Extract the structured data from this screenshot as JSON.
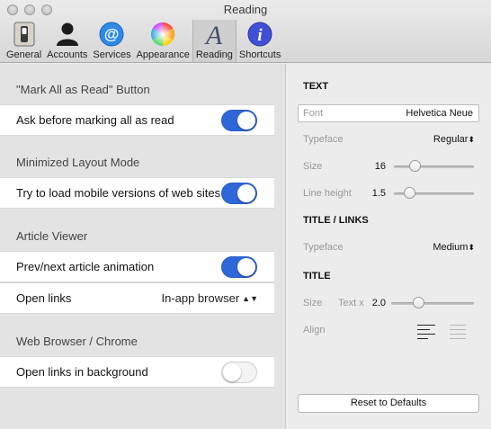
{
  "window": {
    "title": "Reading"
  },
  "toolbar": {
    "items": [
      {
        "label": "General",
        "icon": "switch-icon"
      },
      {
        "label": "Accounts",
        "icon": "person-icon"
      },
      {
        "label": "Services",
        "icon": "at-sign-icon"
      },
      {
        "label": "Appearance",
        "icon": "color-wheel-icon"
      },
      {
        "label": "Reading",
        "icon": "typeface-a-icon"
      },
      {
        "label": "Shortcuts",
        "icon": "info-icon"
      }
    ],
    "active": "Reading"
  },
  "left": {
    "sections": [
      {
        "header": "\"Mark All as Read\" Button"
      },
      {
        "header": "Minimized Layout Mode"
      },
      {
        "header": "Article Viewer"
      },
      {
        "header": "Web Browser / Chrome"
      }
    ],
    "rows": {
      "ask_before": {
        "label": "Ask before marking all as read",
        "on": true
      },
      "mobile_versions": {
        "label": "Try to load mobile versions of web sites",
        "on": true
      },
      "prev_next": {
        "label": "Prev/next article animation",
        "on": true
      },
      "open_links": {
        "label": "Open links",
        "value": "In-app browser"
      },
      "open_background": {
        "label": "Open links in background",
        "on": false
      }
    }
  },
  "right": {
    "text_header": "TEXT",
    "font": {
      "label": "Font",
      "value": "Helvetica Neue"
    },
    "typeface": {
      "label": "Typeface",
      "value": "Regular"
    },
    "size": {
      "label": "Size",
      "value": "16",
      "fraction": 0.22
    },
    "line_height": {
      "label": "Line height",
      "value": "1.5",
      "fraction": 0.15
    },
    "title_links_header": "TITLE / LINKS",
    "title_links_typeface": {
      "label": "Typeface",
      "value": "Medium"
    },
    "title_header": "TITLE",
    "title_size": {
      "label": "Size",
      "prefix": "Text x",
      "value": "2.0",
      "fraction": 0.3
    },
    "align": {
      "label": "Align",
      "selected": "left"
    },
    "reset_label": "Reset to Defaults"
  },
  "colors": {
    "accent": "#2f67d8"
  }
}
